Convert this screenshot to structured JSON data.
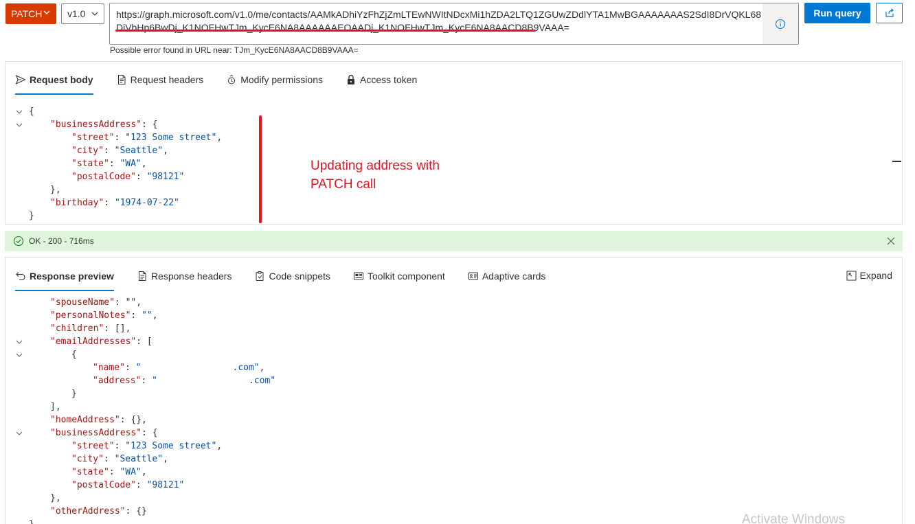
{
  "toolbar": {
    "method": "PATCH",
    "version": "v1.0",
    "url": "https://graph.microsoft.com/v1.0/me/contacts/AAMkADhiYzFhZjZmLTEwNWItNDcxMi1hZDA2LTQ1ZGUwZDdlYTA1MwBGAAAAAAAS2SdI8DrVQKL68DiVbHp6BwDj_K1NOFHwTJm_KycE6NA8AAAAAAEOAADj_K1NOFHwTJm_KycE6NA8AACD8B9VAAA=",
    "url_error": "Possible error found in URL near: TJm_KycE6NA8AACD8B9VAAA=",
    "run_label": "Run query"
  },
  "request_tabs": [
    {
      "label": "Request body",
      "icon": "send-icon"
    },
    {
      "label": "Request headers",
      "icon": "document-icon"
    },
    {
      "label": "Modify permissions",
      "icon": "permissions-icon"
    },
    {
      "label": "Access token",
      "icon": "lock-icon"
    }
  ],
  "request_body": [
    {
      "text": "{",
      "parts": [
        [
          "p",
          "{"
        ]
      ]
    },
    {
      "parts": [
        [
          "k",
          "\"businessAddress\""
        ],
        [
          "p",
          ": {"
        ]
      ]
    },
    {
      "parts": [
        [
          "k",
          "\"street\""
        ],
        [
          "p",
          ": "
        ],
        [
          "s",
          "\"123 Some street\""
        ],
        [
          "p",
          ","
        ]
      ]
    },
    {
      "parts": [
        [
          "k",
          "\"city\""
        ],
        [
          "p",
          ": "
        ],
        [
          "s",
          "\"Seattle\""
        ],
        [
          "p",
          ","
        ]
      ]
    },
    {
      "parts": [
        [
          "k",
          "\"state\""
        ],
        [
          "p",
          ": "
        ],
        [
          "s",
          "\"WA\""
        ],
        [
          "p",
          ","
        ]
      ]
    },
    {
      "parts": [
        [
          "k",
          "\"postalCode\""
        ],
        [
          "p",
          ": "
        ],
        [
          "s",
          "\"98121\""
        ]
      ]
    },
    {
      "parts": [
        [
          "p",
          "},"
        ]
      ]
    },
    {
      "parts": [
        [
          "k",
          "\"birthday\""
        ],
        [
          "p",
          ": "
        ],
        [
          "s",
          "\"1974-07-22\""
        ]
      ]
    },
    {
      "parts": [
        [
          "p",
          "}"
        ]
      ]
    }
  ],
  "annotation": {
    "line1": "Updating address with",
    "line2": "PATCH call"
  },
  "status": {
    "text": "OK - 200 - 716ms",
    "color": "#dff6dd"
  },
  "response_tabs": [
    {
      "label": "Response preview",
      "icon": "undo-icon"
    },
    {
      "label": "Response headers",
      "icon": "document-icon"
    },
    {
      "label": "Code snippets",
      "icon": "clipboard-icon"
    },
    {
      "label": "Toolkit component",
      "icon": "toolkit-icon"
    },
    {
      "label": "Adaptive cards",
      "icon": "card-icon"
    }
  ],
  "expand_label": "Expand",
  "response_body": [
    {
      "parts": [
        [
          "k",
          "\"spouseName\""
        ],
        [
          "p",
          ": \"\","
        ]
      ]
    },
    {
      "parts": [
        [
          "k",
          "\"personalNotes\""
        ],
        [
          "p",
          ": "
        ],
        [
          "s",
          "\"\""
        ],
        [
          "p",
          ","
        ]
      ]
    },
    {
      "parts": [
        [
          "k",
          "\"children\""
        ],
        [
          "p",
          ": [],"
        ]
      ]
    },
    {
      "parts": [
        [
          "k",
          "\"emailAddresses\""
        ],
        [
          "p",
          ": ["
        ]
      ]
    },
    {
      "parts": [
        [
          "p",
          "{"
        ]
      ]
    },
    {
      "parts": [
        [
          "k",
          "\"name\""
        ],
        [
          "p",
          ": "
        ],
        [
          "s",
          "\"                 .com\""
        ],
        [
          "p",
          ","
        ]
      ]
    },
    {
      "parts": [
        [
          "k",
          "\"address\""
        ],
        [
          "p",
          ": "
        ],
        [
          "s",
          "\"                 .com\""
        ]
      ]
    },
    {
      "parts": [
        [
          "p",
          "}"
        ]
      ]
    },
    {
      "parts": [
        [
          "p",
          "],"
        ]
      ]
    },
    {
      "parts": [
        [
          "k",
          "\"homeAddress\""
        ],
        [
          "p",
          ": {},"
        ]
      ]
    },
    {
      "parts": [
        [
          "k",
          "\"businessAddress\""
        ],
        [
          "p",
          ": {"
        ]
      ]
    },
    {
      "parts": [
        [
          "k",
          "\"street\""
        ],
        [
          "p",
          ": "
        ],
        [
          "s",
          "\"123 Some street\""
        ],
        [
          "p",
          ","
        ]
      ]
    },
    {
      "parts": [
        [
          "k",
          "\"city\""
        ],
        [
          "p",
          ": "
        ],
        [
          "s",
          "\"Seattle\""
        ],
        [
          "p",
          ","
        ]
      ]
    },
    {
      "parts": [
        [
          "k",
          "\"state\""
        ],
        [
          "p",
          ": "
        ],
        [
          "s",
          "\"WA\""
        ],
        [
          "p",
          ","
        ]
      ]
    },
    {
      "parts": [
        [
          "k",
          "\"postalCode\""
        ],
        [
          "p",
          ": "
        ],
        [
          "s",
          "\"98121\""
        ]
      ]
    },
    {
      "parts": [
        [
          "p",
          "},"
        ]
      ]
    },
    {
      "parts": [
        [
          "k",
          "\"otherAddress\""
        ],
        [
          "p",
          ": {}"
        ]
      ]
    },
    {
      "parts": [
        [
          "p",
          "}"
        ]
      ]
    }
  ],
  "watermark": "Activate Windows",
  "colors": {
    "method": "#d83b01",
    "primary": "#0078d4",
    "annotation": "#e81123",
    "key": "#a31515",
    "string": "#0451a5"
  }
}
